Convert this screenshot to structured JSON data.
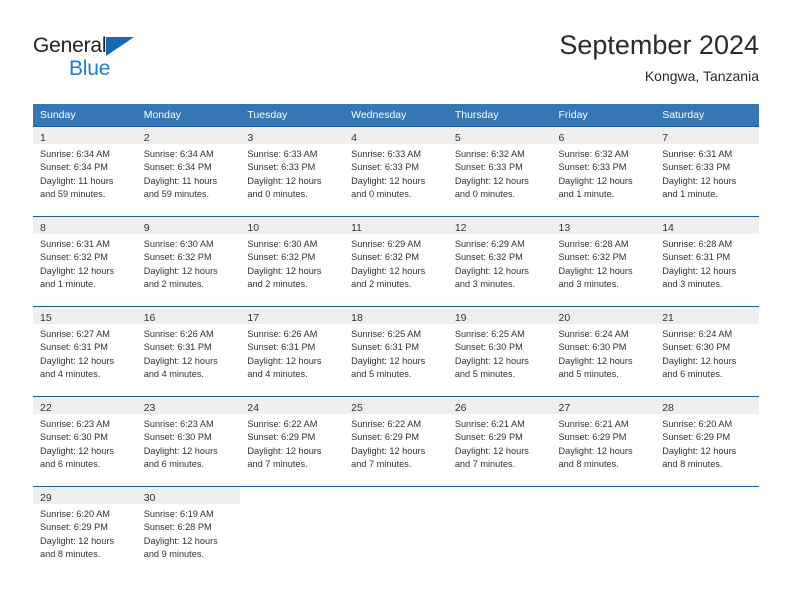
{
  "brand": {
    "line1": "General",
    "line2": "Blue",
    "triangle_color": "#1569b0",
    "line2_color": "#1b7fd4"
  },
  "header": {
    "title": "September 2024",
    "subtitle": "Kongwa, Tanzania"
  },
  "theme": {
    "header_bg": "#3576b5",
    "header_text": "#ffffff",
    "daynum_band_bg": "#efefef",
    "cell_border": "#1f5f9e",
    "body_text": "#333333"
  },
  "weekday_headers": [
    "Sunday",
    "Monday",
    "Tuesday",
    "Wednesday",
    "Thursday",
    "Friday",
    "Saturday"
  ],
  "weeks": [
    [
      {
        "day": "1",
        "sunrise": "Sunrise: 6:34 AM",
        "sunset": "Sunset: 6:34 PM",
        "daylight1": "Daylight: 11 hours",
        "daylight2": "and 59 minutes."
      },
      {
        "day": "2",
        "sunrise": "Sunrise: 6:34 AM",
        "sunset": "Sunset: 6:34 PM",
        "daylight1": "Daylight: 11 hours",
        "daylight2": "and 59 minutes."
      },
      {
        "day": "3",
        "sunrise": "Sunrise: 6:33 AM",
        "sunset": "Sunset: 6:33 PM",
        "daylight1": "Daylight: 12 hours",
        "daylight2": "and 0 minutes."
      },
      {
        "day": "4",
        "sunrise": "Sunrise: 6:33 AM",
        "sunset": "Sunset: 6:33 PM",
        "daylight1": "Daylight: 12 hours",
        "daylight2": "and 0 minutes."
      },
      {
        "day": "5",
        "sunrise": "Sunrise: 6:32 AM",
        "sunset": "Sunset: 6:33 PM",
        "daylight1": "Daylight: 12 hours",
        "daylight2": "and 0 minutes."
      },
      {
        "day": "6",
        "sunrise": "Sunrise: 6:32 AM",
        "sunset": "Sunset: 6:33 PM",
        "daylight1": "Daylight: 12 hours",
        "daylight2": "and 1 minute."
      },
      {
        "day": "7",
        "sunrise": "Sunrise: 6:31 AM",
        "sunset": "Sunset: 6:33 PM",
        "daylight1": "Daylight: 12 hours",
        "daylight2": "and 1 minute."
      }
    ],
    [
      {
        "day": "8",
        "sunrise": "Sunrise: 6:31 AM",
        "sunset": "Sunset: 6:32 PM",
        "daylight1": "Daylight: 12 hours",
        "daylight2": "and 1 minute."
      },
      {
        "day": "9",
        "sunrise": "Sunrise: 6:30 AM",
        "sunset": "Sunset: 6:32 PM",
        "daylight1": "Daylight: 12 hours",
        "daylight2": "and 2 minutes."
      },
      {
        "day": "10",
        "sunrise": "Sunrise: 6:30 AM",
        "sunset": "Sunset: 6:32 PM",
        "daylight1": "Daylight: 12 hours",
        "daylight2": "and 2 minutes."
      },
      {
        "day": "11",
        "sunrise": "Sunrise: 6:29 AM",
        "sunset": "Sunset: 6:32 PM",
        "daylight1": "Daylight: 12 hours",
        "daylight2": "and 2 minutes."
      },
      {
        "day": "12",
        "sunrise": "Sunrise: 6:29 AM",
        "sunset": "Sunset: 6:32 PM",
        "daylight1": "Daylight: 12 hours",
        "daylight2": "and 3 minutes."
      },
      {
        "day": "13",
        "sunrise": "Sunrise: 6:28 AM",
        "sunset": "Sunset: 6:32 PM",
        "daylight1": "Daylight: 12 hours",
        "daylight2": "and 3 minutes."
      },
      {
        "day": "14",
        "sunrise": "Sunrise: 6:28 AM",
        "sunset": "Sunset: 6:31 PM",
        "daylight1": "Daylight: 12 hours",
        "daylight2": "and 3 minutes."
      }
    ],
    [
      {
        "day": "15",
        "sunrise": "Sunrise: 6:27 AM",
        "sunset": "Sunset: 6:31 PM",
        "daylight1": "Daylight: 12 hours",
        "daylight2": "and 4 minutes."
      },
      {
        "day": "16",
        "sunrise": "Sunrise: 6:26 AM",
        "sunset": "Sunset: 6:31 PM",
        "daylight1": "Daylight: 12 hours",
        "daylight2": "and 4 minutes."
      },
      {
        "day": "17",
        "sunrise": "Sunrise: 6:26 AM",
        "sunset": "Sunset: 6:31 PM",
        "daylight1": "Daylight: 12 hours",
        "daylight2": "and 4 minutes."
      },
      {
        "day": "18",
        "sunrise": "Sunrise: 6:25 AM",
        "sunset": "Sunset: 6:31 PM",
        "daylight1": "Daylight: 12 hours",
        "daylight2": "and 5 minutes."
      },
      {
        "day": "19",
        "sunrise": "Sunrise: 6:25 AM",
        "sunset": "Sunset: 6:30 PM",
        "daylight1": "Daylight: 12 hours",
        "daylight2": "and 5 minutes."
      },
      {
        "day": "20",
        "sunrise": "Sunrise: 6:24 AM",
        "sunset": "Sunset: 6:30 PM",
        "daylight1": "Daylight: 12 hours",
        "daylight2": "and 5 minutes."
      },
      {
        "day": "21",
        "sunrise": "Sunrise: 6:24 AM",
        "sunset": "Sunset: 6:30 PM",
        "daylight1": "Daylight: 12 hours",
        "daylight2": "and 6 minutes."
      }
    ],
    [
      {
        "day": "22",
        "sunrise": "Sunrise: 6:23 AM",
        "sunset": "Sunset: 6:30 PM",
        "daylight1": "Daylight: 12 hours",
        "daylight2": "and 6 minutes."
      },
      {
        "day": "23",
        "sunrise": "Sunrise: 6:23 AM",
        "sunset": "Sunset: 6:30 PM",
        "daylight1": "Daylight: 12 hours",
        "daylight2": "and 6 minutes."
      },
      {
        "day": "24",
        "sunrise": "Sunrise: 6:22 AM",
        "sunset": "Sunset: 6:29 PM",
        "daylight1": "Daylight: 12 hours",
        "daylight2": "and 7 minutes."
      },
      {
        "day": "25",
        "sunrise": "Sunrise: 6:22 AM",
        "sunset": "Sunset: 6:29 PM",
        "daylight1": "Daylight: 12 hours",
        "daylight2": "and 7 minutes."
      },
      {
        "day": "26",
        "sunrise": "Sunrise: 6:21 AM",
        "sunset": "Sunset: 6:29 PM",
        "daylight1": "Daylight: 12 hours",
        "daylight2": "and 7 minutes."
      },
      {
        "day": "27",
        "sunrise": "Sunrise: 6:21 AM",
        "sunset": "Sunset: 6:29 PM",
        "daylight1": "Daylight: 12 hours",
        "daylight2": "and 8 minutes."
      },
      {
        "day": "28",
        "sunrise": "Sunrise: 6:20 AM",
        "sunset": "Sunset: 6:29 PM",
        "daylight1": "Daylight: 12 hours",
        "daylight2": "and 8 minutes."
      }
    ],
    [
      {
        "day": "29",
        "sunrise": "Sunrise: 6:20 AM",
        "sunset": "Sunset: 6:29 PM",
        "daylight1": "Daylight: 12 hours",
        "daylight2": "and 8 minutes."
      },
      {
        "day": "30",
        "sunrise": "Sunrise: 6:19 AM",
        "sunset": "Sunset: 6:28 PM",
        "daylight1": "Daylight: 12 hours",
        "daylight2": "and 9 minutes."
      },
      {
        "day": "",
        "sunrise": "",
        "sunset": "",
        "daylight1": "",
        "daylight2": ""
      },
      {
        "day": "",
        "sunrise": "",
        "sunset": "",
        "daylight1": "",
        "daylight2": ""
      },
      {
        "day": "",
        "sunrise": "",
        "sunset": "",
        "daylight1": "",
        "daylight2": ""
      },
      {
        "day": "",
        "sunrise": "",
        "sunset": "",
        "daylight1": "",
        "daylight2": ""
      },
      {
        "day": "",
        "sunrise": "",
        "sunset": "",
        "daylight1": "",
        "daylight2": ""
      }
    ]
  ]
}
